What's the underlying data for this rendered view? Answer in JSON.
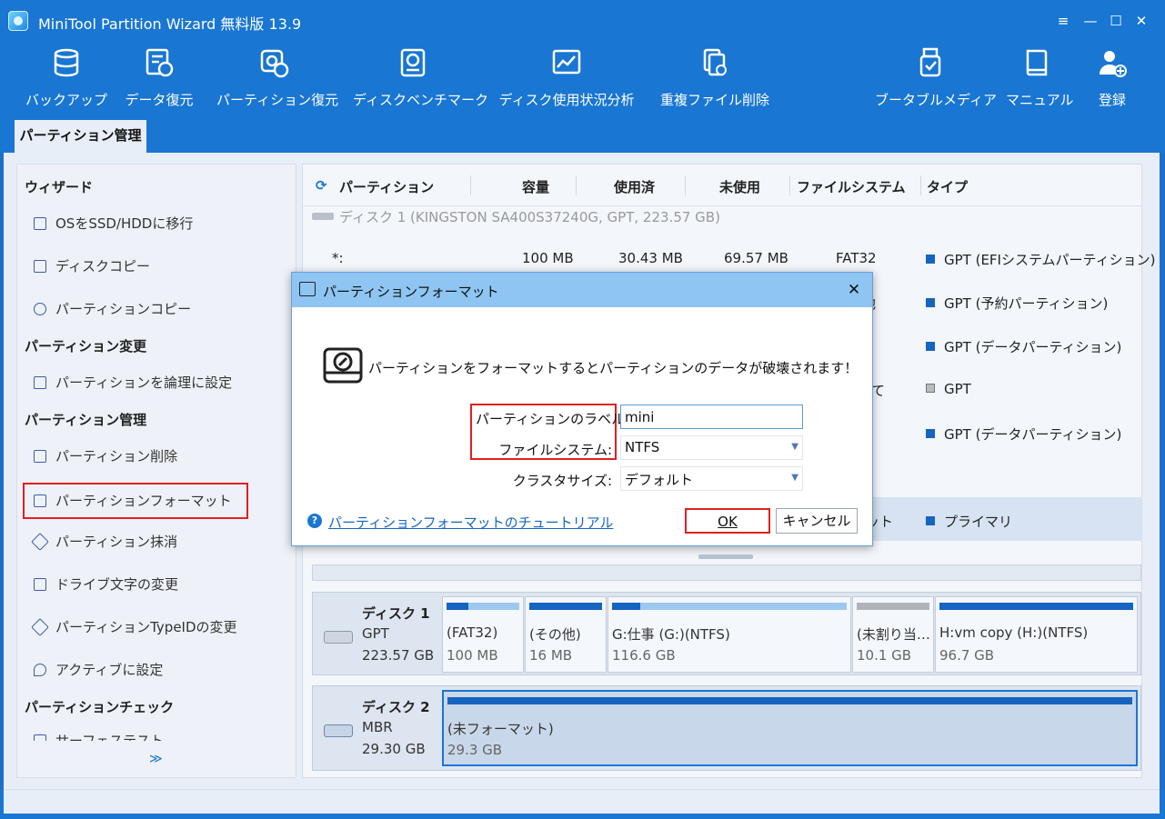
{
  "window": {
    "title": "MiniTool Partition Wizard 無料版 13.9",
    "controls": [
      "≡",
      "—",
      "☐",
      "✕"
    ]
  },
  "toolbar": {
    "backup": "バックアップ",
    "data_recovery": "データ復元",
    "partition_recovery": "パーティション復元",
    "disk_benchmark": "ディスクベンチマーク",
    "space_analyzer": "ディスク使用状況分析",
    "duplicate_delete": "重複ファイル削除",
    "bootable_media": "ブータブルメディア",
    "manual": "マニュアル",
    "register": "登録"
  },
  "tabs": {
    "partition_management": "パーティション管理"
  },
  "sidebar": {
    "wizard": {
      "title": "ウィザード",
      "items": [
        "OSをSSD/HDDに移行",
        "ディスクコピー",
        "パーティションコピー"
      ]
    },
    "change": {
      "title": "パーティション変更",
      "items": [
        "パーティションを論理に設定"
      ]
    },
    "manage": {
      "title": "パーティション管理",
      "items": [
        "パーティション削除",
        "パーティションフォーマット",
        "パーティション抹消",
        "ドライブ文字の変更",
        "パーティションTypeIDの変更",
        "アクティブに設定"
      ]
    },
    "check": {
      "title": "パーティションチェック",
      "items": [
        "サーフェステスト"
      ]
    },
    "more": "≫"
  },
  "table": {
    "columns": {
      "partition": "パーティション",
      "capacity": "容量",
      "used": "使用済",
      "unused": "未使用",
      "filesystem": "ファイルシステム",
      "type": "タイプ"
    },
    "disk1_title": "ディスク 1 (KINGSTON SA400S37240G, GPT, 223.57 GB)",
    "rows": [
      {
        "name": "*:",
        "capacity": "100 MB",
        "used": "30.43 MB",
        "unused": "69.57 MB",
        "fs": "FAT32",
        "type": "GPT (EFIシステムパーティション)"
      },
      {
        "fs_partial": "他",
        "type": "GPT (予約パーティション)"
      },
      {
        "type": "GPT (データパーティション)"
      },
      {
        "fs_partial": "当て",
        "type": "GPT"
      },
      {
        "type": "GPT (データパーティション)"
      },
      {
        "fs_partial": "マット",
        "type": "プライマリ"
      }
    ]
  },
  "diskmap": {
    "disk1": {
      "name": "ディスク 1",
      "scheme": "GPT",
      "size": "223.57 GB",
      "parts": [
        {
          "label": "(FAT32)",
          "size": "100 MB",
          "used": 0.3
        },
        {
          "label": "(その他)",
          "size": "16 MB",
          "used": 1.0
        },
        {
          "label": "G:仕事 (G:)(NTFS)",
          "size": "116.6 GB",
          "used": 0.12
        },
        {
          "label": "(未割り当…",
          "size": "10.1 GB",
          "used": 0
        },
        {
          "label": "H:vm copy (H:)(NTFS)",
          "size": "96.7 GB",
          "used": 1.0
        }
      ]
    },
    "disk2": {
      "name": "ディスク 2",
      "scheme": "MBR",
      "size": "29.30 GB",
      "parts": [
        {
          "label": "(未フォーマット)",
          "size": "29.3 GB",
          "used": 1.0
        }
      ]
    }
  },
  "dialog": {
    "title": "パーティションフォーマット",
    "warning": "パーティションをフォーマットするとパーティションのデータが破壊されます！",
    "label_caption": "パーティションのラベル:",
    "label_value": "mini",
    "fs_caption": "ファイルシステム:",
    "fs_value": "NTFS",
    "cluster_caption": "クラスタサイズ:",
    "cluster_value": "デフォルト",
    "help_link": "パーティションフォーマットのチュートリアル",
    "ok": "OK",
    "cancel": "キャンセル"
  },
  "colors": {
    "brand": "#1976d2",
    "dialog_title": "#8ec5f2",
    "highlight": "#e02020",
    "partition_bar": "#1565c0"
  }
}
